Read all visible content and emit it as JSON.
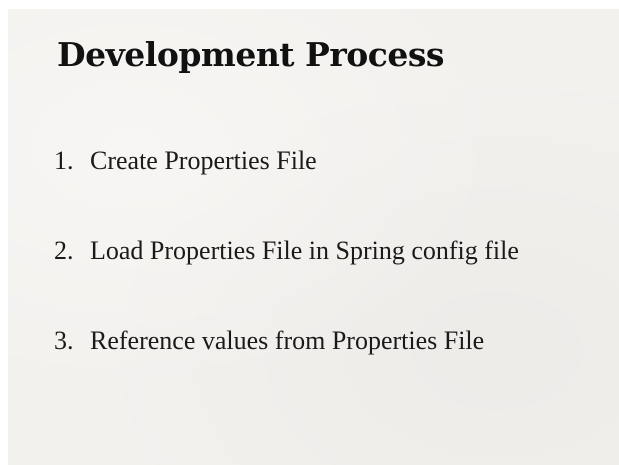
{
  "slide": {
    "title": "Development Process",
    "steps": [
      {
        "number": "1.",
        "text": "Create Properties File"
      },
      {
        "number": "2.",
        "text": "Load Properties File in Spring config file"
      },
      {
        "number": "3.",
        "text": "Reference values from Properties File"
      }
    ]
  }
}
